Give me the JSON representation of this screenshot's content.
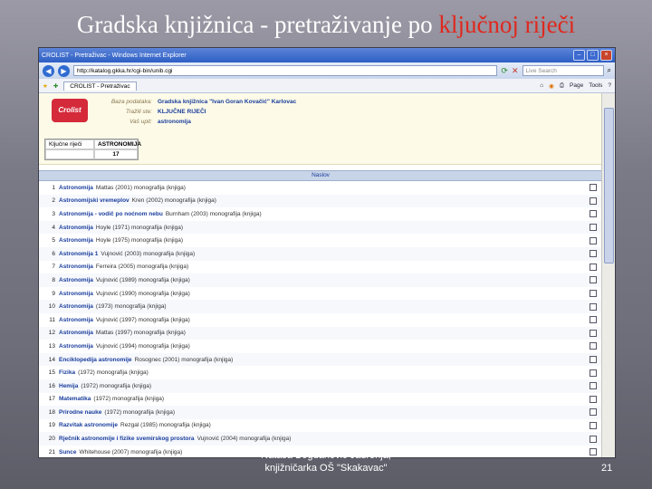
{
  "slide": {
    "title_plain": "Gradska knjižnica - pretraživanje po ",
    "title_highlight": "ključnoj riječi",
    "footer_line1": "Nataša Bogdanović Jadronja,",
    "footer_line2": "knjižničarka OŠ \"Skakavac\"",
    "page_number": "21"
  },
  "browser": {
    "window_title": "CROLIST - Pretraživac - Windows Internet Explorer",
    "url": "http://katalog.gkka.hr/cgi-bin/unib.cgi",
    "search_placeholder": "Live Search",
    "tab_label": "CROLIST - Pretraživac",
    "tools": [
      "Page",
      "Tools"
    ]
  },
  "catalog": {
    "logo_text": "Crolist",
    "meta": [
      {
        "key": "Baza podataka:",
        "value": "Gradska knjižnica \"Ivan Goran Kovačić\" Karlovac"
      },
      {
        "key": "Tražili ste:",
        "value": "KLJUČNE RIJEČI"
      },
      {
        "key": "Vaš upit:",
        "value": "astronomija"
      }
    ],
    "keyword_label": "Ključne riječi",
    "keyword_value": "ASTRONOMIJA",
    "count_label": "",
    "count_value": "17",
    "results_header": "Naslov",
    "rows": [
      {
        "n": "1",
        "title": "Astronomija",
        "rest": "Mattas (2001) monografija (knjiga)"
      },
      {
        "n": "2",
        "title": "Astronomijski vremeplov",
        "rest": "Kren (2002) monografija (knjiga)"
      },
      {
        "n": "3",
        "title": "Astronomija - vodič po noćnom nebu",
        "rest": "Burnham (2003) monografija (knjiga)"
      },
      {
        "n": "4",
        "title": "Astronomija",
        "rest": "Hoyle (1971) monografija (knjiga)"
      },
      {
        "n": "5",
        "title": "Astronomija",
        "rest": "Hoyle (1975) monografija (knjiga)"
      },
      {
        "n": "6",
        "title": "Astronomija 1",
        "rest": "Vujnović (2003) monografija (knjiga)"
      },
      {
        "n": "7",
        "title": "Astronomija",
        "rest": "Ferreira (2005) monografija (knjiga)"
      },
      {
        "n": "8",
        "title": "Astronomija",
        "rest": "Vujnović (1989) monografija (knjiga)"
      },
      {
        "n": "9",
        "title": "Astronomija",
        "rest": "Vujnović (1990) monografija (knjiga)"
      },
      {
        "n": "10",
        "title": "Astronomija",
        "rest": "(1973) monografija (knjiga)"
      },
      {
        "n": "11",
        "title": "Astronomija",
        "rest": "Vujnović (1997) monografija (knjiga)"
      },
      {
        "n": "12",
        "title": "Astronomija",
        "rest": "Mattas (1997) monografija (knjiga)"
      },
      {
        "n": "13",
        "title": "Astronomija",
        "rest": "Vujnović (1994) monografija (knjiga)"
      },
      {
        "n": "14",
        "title": "Enciklopedija astronomije",
        "rest": "Rosognec (2001) monografija (knjiga)"
      },
      {
        "n": "15",
        "title": "Fizika",
        "rest": "(1972) monografija (knjiga)"
      },
      {
        "n": "16",
        "title": "Hemija",
        "rest": "(1972) monografija (knjiga)"
      },
      {
        "n": "17",
        "title": "Matematika",
        "rest": "(1972) monografija (knjiga)"
      },
      {
        "n": "18",
        "title": "Prirodne nauke",
        "rest": "(1972) monografija (knjiga)"
      },
      {
        "n": "19",
        "title": "Razvitak astronomije",
        "rest": "Rezgal (1985) monografija (knjiga)"
      },
      {
        "n": "20",
        "title": "Rječnik astronomije i fizike svemirskog prostora",
        "rest": "Vujnović (2004) monografija (knjiga)"
      },
      {
        "n": "21",
        "title": "Sunce",
        "rest": "Whitehouse (2007) monografija (knjiga)"
      }
    ]
  },
  "colors": {
    "highlight": "#e0281e",
    "link": "#1a3d9c"
  }
}
